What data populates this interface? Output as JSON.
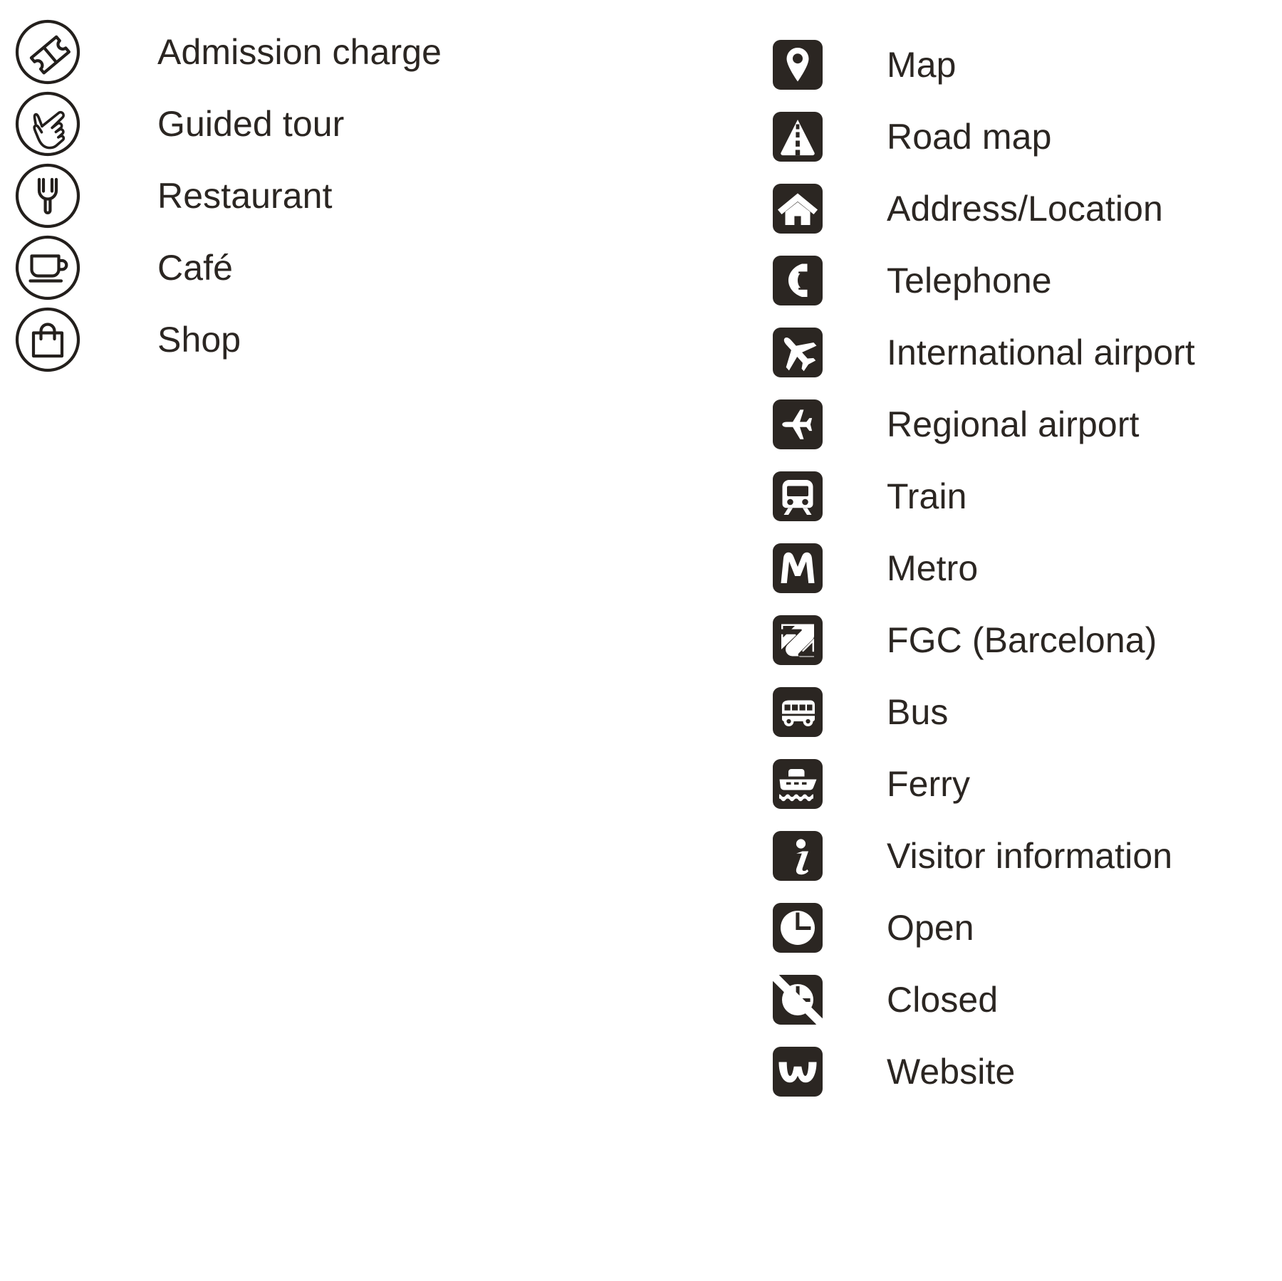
{
  "page": {
    "title": "Legend key",
    "background_color": "#ffffff",
    "text_color": "#2b2622",
    "icon_fill_color": "#2b2622"
  },
  "columns": [
    {
      "name": "facilities",
      "icon_style": "outline-circle",
      "items": [
        {
          "icon": "ticket-icon",
          "label": "Admission charge"
        },
        {
          "icon": "pointing-hand-icon",
          "label": "Guided tour"
        },
        {
          "icon": "fork-icon",
          "label": "Restaurant"
        },
        {
          "icon": "coffee-cup-icon",
          "label": "Café"
        },
        {
          "icon": "shopping-bag-icon",
          "label": "Shop"
        }
      ]
    },
    {
      "name": "practical-information",
      "icon_style": "solid-rounded-square",
      "items": [
        {
          "icon": "map-pin-icon",
          "label": "Map"
        },
        {
          "icon": "road-icon",
          "label": "Road map"
        },
        {
          "icon": "house-icon",
          "label": "Address/Location"
        },
        {
          "icon": "telephone-icon",
          "label": "Telephone"
        },
        {
          "icon": "airplane-diagonal-icon",
          "label": "International airport"
        },
        {
          "icon": "airplane-level-icon",
          "label": "Regional airport"
        },
        {
          "icon": "train-icon",
          "label": "Train"
        },
        {
          "icon": "metro-m-icon",
          "label": "Metro"
        },
        {
          "icon": "fgc-logo-icon",
          "label": "FGC (Barcelona)"
        },
        {
          "icon": "bus-icon",
          "label": "Bus"
        },
        {
          "icon": "ferry-icon",
          "label": "Ferry"
        },
        {
          "icon": "information-i-icon",
          "label": "Visitor information"
        },
        {
          "icon": "clock-icon",
          "label": "Open"
        },
        {
          "icon": "clock-slashed-icon",
          "label": "Closed"
        },
        {
          "icon": "website-w-icon",
          "label": "Website"
        }
      ]
    }
  ]
}
